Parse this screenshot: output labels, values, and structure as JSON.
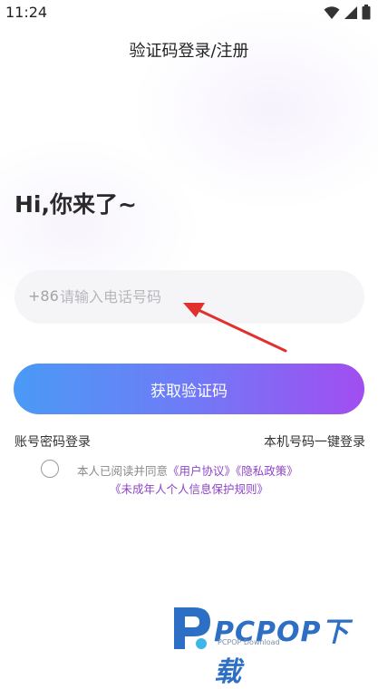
{
  "status_bar": {
    "time": "11:24",
    "icons": [
      "wifi-icon",
      "signal-icon",
      "battery-icon"
    ]
  },
  "header": {
    "title": "验证码登录/注册"
  },
  "greeting": "Hi,你来了~",
  "phone": {
    "prefix": "+86",
    "placeholder": "请输入电话号码",
    "value": ""
  },
  "actions": {
    "get_code_label": "获取验证码",
    "password_login": "账号密码登录",
    "one_tap_login": "本机号码一键登录"
  },
  "agreement": {
    "checked": false,
    "prefix_text": "本人已阅读并同意",
    "user_agreement": "《用户协议》",
    "privacy_policy": "《隐私政策》",
    "minor_rules": "《未成年人个人信息保护规则》"
  },
  "watermark": {
    "brand": "PCPOP下载",
    "sub": "PCPOP Download"
  },
  "colors": {
    "button_gradient_start": "#4a9af6",
    "button_gradient_end": "#a24df0",
    "link_purple": "#8e44c9",
    "arrow_red": "#e0312f"
  }
}
